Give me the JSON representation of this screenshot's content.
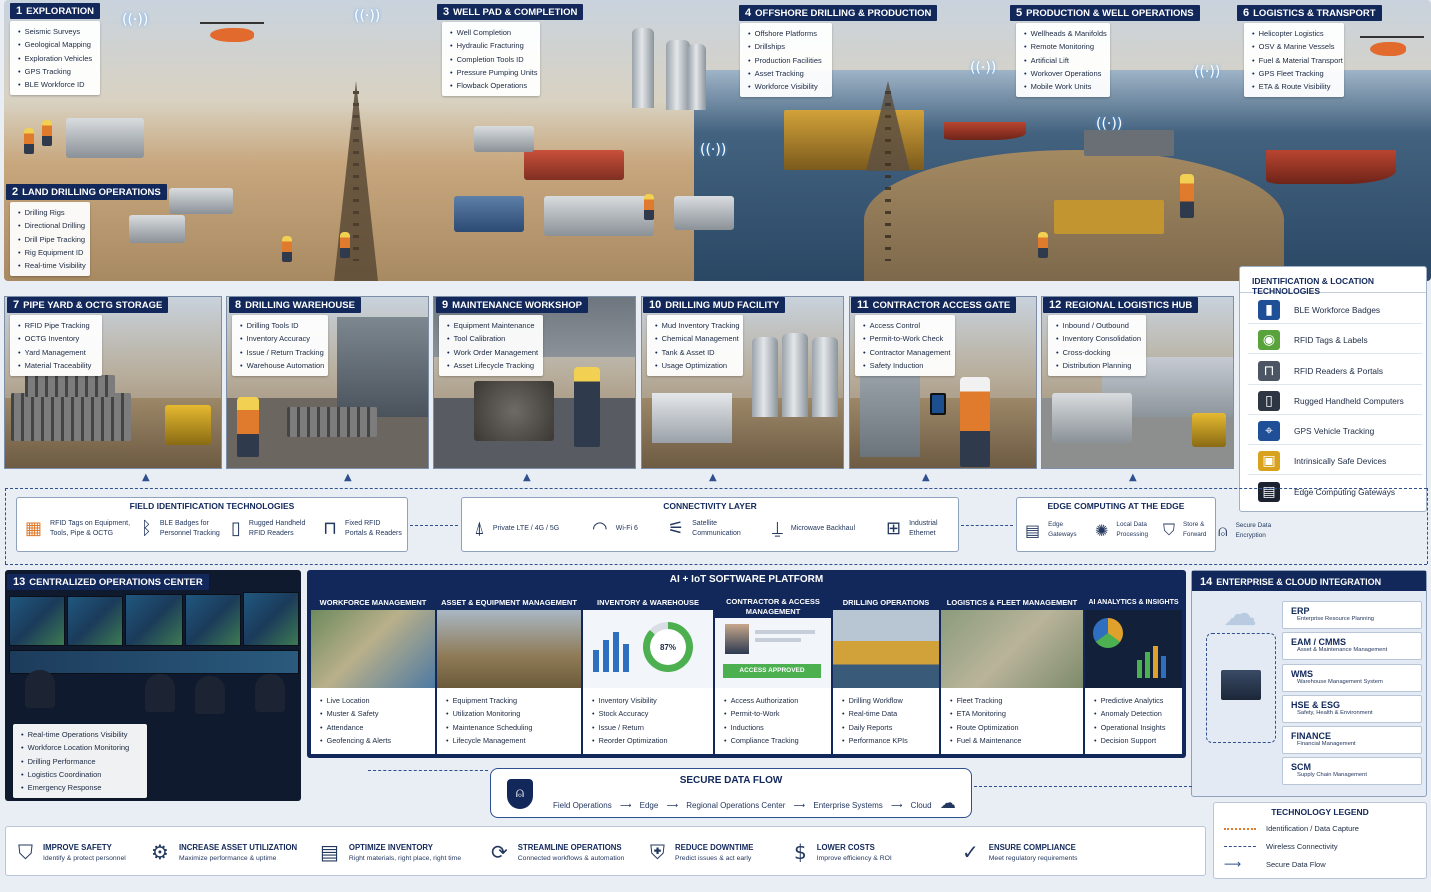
{
  "scene": {
    "sections": [
      {
        "num": "1",
        "title": "EXPLORATION",
        "items": [
          "Seismic Surveys",
          "Geological Mapping",
          "Exploration Vehicles",
          "GPS Tracking",
          "BLE Workforce ID"
        ]
      },
      {
        "num": "2",
        "title": "LAND DRILLING OPERATIONS",
        "items": [
          "Drilling Rigs",
          "Directional Drilling",
          "Drill Pipe Tracking",
          "Rig Equipment ID",
          "Real-time Visibility"
        ]
      },
      {
        "num": "3",
        "title": "WELL PAD & COMPLETION",
        "items": [
          "Well Completion",
          "Hydraulic Fracturing",
          "Completion Tools ID",
          "Pressure Pumping Units",
          "Flowback Operations"
        ]
      },
      {
        "num": "4",
        "title": "OFFSHORE DRILLING & PRODUCTION",
        "items": [
          "Offshore Platforms",
          "Drillships",
          "Production Facilities",
          "Asset Tracking",
          "Workforce Visibility"
        ]
      },
      {
        "num": "5",
        "title": "PRODUCTION & WELL OPERATIONS",
        "items": [
          "Wellheads & Manifolds",
          "Remote Monitoring",
          "Artificial Lift",
          "Workover Operations",
          "Mobile Work Units"
        ]
      },
      {
        "num": "6",
        "title": "LOGISTICS & TRANSPORT",
        "items": [
          "Helicopter Logistics",
          "OSV & Marine Vessels",
          "Fuel & Material Transport",
          "GPS Fleet Tracking",
          "ETA & Route Visibility"
        ]
      }
    ]
  },
  "facilities": [
    {
      "num": "7",
      "title": "PIPE YARD & OCTG STORAGE",
      "items": [
        "RFID Pipe Tracking",
        "OCTG Inventory",
        "Yard Management",
        "Material Traceability"
      ]
    },
    {
      "num": "8",
      "title": "DRILLING WAREHOUSE",
      "items": [
        "Drilling Tools ID",
        "Inventory Accuracy",
        "Issue / Return Tracking",
        "Warehouse Automation"
      ]
    },
    {
      "num": "9",
      "title": "MAINTENANCE WORKSHOP",
      "items": [
        "Equipment Maintenance",
        "Tool Calibration",
        "Work Order Management",
        "Asset Lifecycle Tracking"
      ]
    },
    {
      "num": "10",
      "title": "DRILLING MUD FACILITY",
      "items": [
        "Mud Inventory Tracking",
        "Chemical Management",
        "Tank & Asset ID",
        "Usage Optimization"
      ]
    },
    {
      "num": "11",
      "title": "CONTRACTOR ACCESS GATE",
      "items": [
        "Access Control",
        "Permit-to-Work Check",
        "Contractor Management",
        "Safety Induction"
      ]
    },
    {
      "num": "12",
      "title": "REGIONAL LOGISTICS HUB",
      "items": [
        "Inbound / Outbound",
        "Inventory Consolidation",
        "Cross-docking",
        "Distribution Planning"
      ]
    }
  ],
  "id_tech": {
    "title": "IDENTIFICATION & LOCATION TECHNOLOGIES",
    "items": [
      {
        "label": "BLE Workforce Badges",
        "icon": "badge-icon",
        "color": "#1f4f96"
      },
      {
        "label": "RFID Tags & Labels",
        "icon": "rfid-tag-icon",
        "color": "#5aa33c"
      },
      {
        "label": "RFID Readers & Portals",
        "icon": "portal-icon",
        "color": "#4b5563"
      },
      {
        "label": "Rugged Handheld Computers",
        "icon": "handheld-icon",
        "color": "#2d3642"
      },
      {
        "label": "GPS Vehicle Tracking",
        "icon": "gps-icon",
        "color": "#1f4f96"
      },
      {
        "label": "Intrinsically Safe Devices",
        "icon": "safe-device-icon",
        "color": "#d9a21e"
      },
      {
        "label": "Edge Computing Gateways",
        "icon": "gateway-icon",
        "color": "#1c2230"
      }
    ]
  },
  "field_id": {
    "title": "FIELD IDENTIFICATION TECHNOLOGIES",
    "items": [
      {
        "line1": "RFID Tags on Equipment,",
        "line2": "Tools, Pipe & OCTG",
        "icon": "rfid-tag-icon"
      },
      {
        "line1": "BLE Badges for",
        "line2": "Personnel Tracking",
        "icon": "bluetooth-icon"
      },
      {
        "line1": "Rugged Handheld",
        "line2": "RFID Readers",
        "icon": "handheld-icon"
      },
      {
        "line1": "Fixed RFID",
        "line2": "Portals & Readers",
        "icon": "portal-icon"
      }
    ]
  },
  "connectivity": {
    "title": "CONNECTIVITY LAYER",
    "items": [
      {
        "line1": "Private LTE / 4G / 5G",
        "line2": "",
        "icon": "cell-tower-icon"
      },
      {
        "line1": "Wi-Fi 6",
        "line2": "",
        "icon": "wifi-icon"
      },
      {
        "line1": "Satellite",
        "line2": "Communication",
        "icon": "satellite-icon"
      },
      {
        "line1": "Microwave Backhaul",
        "line2": "",
        "icon": "microwave-icon"
      },
      {
        "line1": "Industrial",
        "line2": "Ethernet",
        "icon": "ethernet-icon"
      }
    ]
  },
  "edge": {
    "title": "EDGE COMPUTING AT THE EDGE",
    "items": [
      {
        "line1": "Edge",
        "line2": "Gateways",
        "icon": "gateway-icon"
      },
      {
        "line1": "Local Data",
        "line2": "Processing",
        "icon": "chip-icon"
      },
      {
        "line1": "Store &",
        "line2": "Forward",
        "icon": "shield-icon"
      },
      {
        "line1": "Secure Data",
        "line2": "Encryption",
        "icon": "lock-icon"
      }
    ]
  },
  "ops_center": {
    "num": "13",
    "title": "CENTRALIZED OPERATIONS CENTER",
    "items": [
      "Real-time Operations Visibility",
      "Workforce Location Monitoring",
      "Drilling Performance",
      "Logistics Coordination",
      "Emergency Response"
    ]
  },
  "platform": {
    "title": "AI + IoT SOFTWARE PLATFORM",
    "modules": [
      {
        "title": "WORKFORCE MANAGEMENT",
        "items": [
          "Live Location",
          "Muster & Safety",
          "Attendance",
          "Geofencing & Alerts"
        ]
      },
      {
        "title": "ASSET & EQUIPMENT MANAGEMENT",
        "items": [
          "Equipment Tracking",
          "Utilization Monitoring",
          "Maintenance Scheduling",
          "Lifecycle Management"
        ]
      },
      {
        "title": "INVENTORY & WAREHOUSE",
        "items": [
          "Inventory Visibility",
          "Stock Accuracy",
          "Issue / Return",
          "Reorder Optimization"
        ],
        "gauge": "87%"
      },
      {
        "title": "CONTRACTOR & ACCESS MANAGEMENT",
        "items": [
          "Access Authorization",
          "Permit-to-Work",
          "Inductions",
          "Compliance Tracking"
        ],
        "badge": "ACCESS APPROVED"
      },
      {
        "title": "DRILLING OPERATIONS",
        "items": [
          "Drilling Workflow",
          "Real-time Data",
          "Daily Reports",
          "Performance KPIs"
        ]
      },
      {
        "title": "LOGISTICS & FLEET MANAGEMENT",
        "items": [
          "Fleet Tracking",
          "ETA Monitoring",
          "Route Optimization",
          "Fuel & Maintenance"
        ]
      },
      {
        "title": "AI ANALYTICS & INSIGHTS",
        "items": [
          "Predictive Analytics",
          "Anomaly Detection",
          "Operational Insights",
          "Decision Support"
        ]
      }
    ]
  },
  "enterprise": {
    "num": "14",
    "title": "ENTERPRISE & CLOUD INTEGRATION",
    "systems": [
      {
        "name": "ERP",
        "desc": "Enterprise Resource Planning"
      },
      {
        "name": "EAM / CMMS",
        "desc": "Asset & Maintenance Management"
      },
      {
        "name": "WMS",
        "desc": "Warehouse Management System"
      },
      {
        "name": "HSE & ESG",
        "desc": "Safety, Health & Environment"
      },
      {
        "name": "FINANCE",
        "desc": "Financial Management"
      },
      {
        "name": "SCM",
        "desc": "Supply Chain Management"
      }
    ]
  },
  "secure_flow": {
    "title": "SECURE DATA FLOW",
    "steps": [
      "Field Operations",
      "Edge",
      "Regional Operations Center",
      "Enterprise Systems",
      "Cloud"
    ]
  },
  "benefits": [
    {
      "title": "IMPROVE SAFETY",
      "desc": "Identify & protect personnel",
      "icon": "safety-icon"
    },
    {
      "title": "INCREASE ASSET UTILIZATION",
      "desc": "Maximize performance & uptime",
      "icon": "gear-icon"
    },
    {
      "title": "OPTIMIZE INVENTORY",
      "desc": "Right materials, right place, right time",
      "icon": "clipboard-icon"
    },
    {
      "title": "STREAMLINE OPERATIONS",
      "desc": "Connected workflows & automation",
      "icon": "cycle-icon"
    },
    {
      "title": "REDUCE DOWNTIME",
      "desc": "Predict issues & act early",
      "icon": "shield-icon"
    },
    {
      "title": "LOWER COSTS",
      "desc": "Improve efficiency & ROI",
      "icon": "dollar-icon"
    },
    {
      "title": "ENSURE COMPLIANCE",
      "desc": "Meet regulatory requirements",
      "icon": "check-shield-icon"
    }
  ],
  "legend": {
    "title": "TECHNOLOGY LEGEND",
    "items": [
      {
        "label": "Identification / Data Capture",
        "style": "dotted",
        "color": "#e07a2c"
      },
      {
        "label": "Wireless Connectivity",
        "style": "dashed",
        "color": "#2f4f8e"
      },
      {
        "label": "Secure Data Flow",
        "style": "arrow",
        "color": "#2f4f8e"
      }
    ]
  }
}
